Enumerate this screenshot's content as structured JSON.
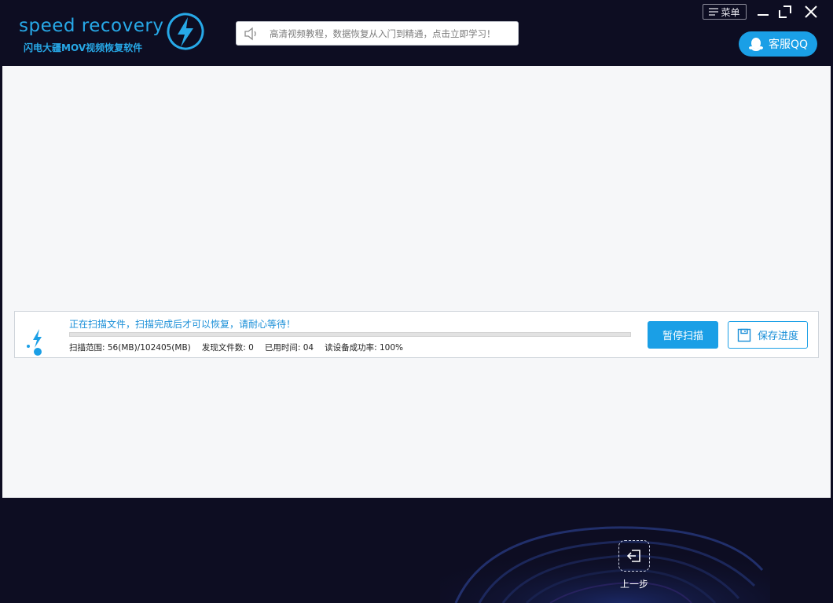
{
  "header": {
    "logo_title": "speed recovery",
    "logo_subtitle": "闪电大疆MOV视频恢复软件",
    "notice_text": "高清视频教程，数据恢复从入门到精通，点击立即学习！",
    "menu_label": "菜单",
    "qq_label": "客服QQ"
  },
  "scan": {
    "status_text": "正在扫描文件，扫描完成后才可以恢复，请耐心等待！",
    "progress": 0.0,
    "stats": {
      "range": "扫描范围: 56(MB)/102405(MB)",
      "found": "发现文件数: 0",
      "elapsed": "已用时间: 04",
      "read_rate": "读设备成功率: 100%"
    },
    "pause_label": "暂停扫描",
    "save_label": "保存进度"
  },
  "footer": {
    "back_label": "上一步"
  },
  "colors": {
    "accent": "#1a9fe6",
    "brand": "#27a9e8",
    "background_dark": "#0d0d22",
    "panel": "#f6f7f9"
  },
  "icons": {
    "logo": "lightning-bolt-icon",
    "notice": "speaker-icon",
    "menu": "hamburger-icon",
    "minimize": "minimize-icon",
    "maximize": "maximize-icon",
    "close": "close-icon",
    "qq": "qq-penguin-icon",
    "scan": "scan-bolt-icon",
    "save": "floppy-disk-icon",
    "back": "back-arrow-icon"
  }
}
